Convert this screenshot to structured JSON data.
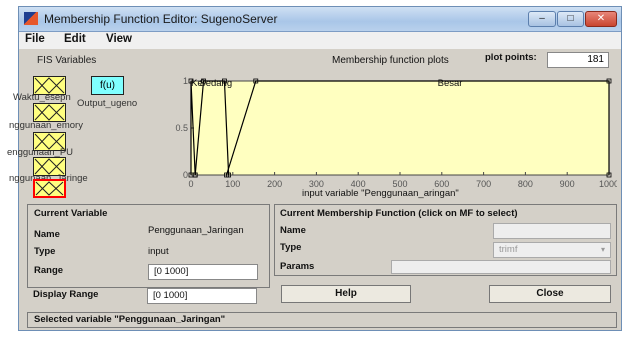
{
  "window": {
    "title": "Membership Function Editor: SugenoServer"
  },
  "menu": [
    "File",
    "Edit",
    "View"
  ],
  "fis": {
    "label": "FIS Variables",
    "output_box": "f(u)",
    "output_name": "Output_ugeno",
    "inputs": [
      "Waktu_eseon",
      "Penggunaan_emory",
      "Penggunaan_PU",
      "Penggunaan_Jaringan",
      "Penggunaan_Jaringan"
    ],
    "input_label_visible": [
      "Waktu_esepn",
      "nggunaan_emory",
      "enggunaan_PU",
      "nggunaan_Jaringe",
      "enggunaan_Jaringa"
    ]
  },
  "plot": {
    "title": "Membership function plots",
    "points_label": "plot points:",
    "points_value": "181",
    "xlabel": "input variable \"Penggunaan_aringan\""
  },
  "chart_data": {
    "type": "line",
    "title": "Membership function plots",
    "xlabel": "input variable \"Penggunaan_aringan\"",
    "ylabel": "",
    "xlim": [
      0,
      1000
    ],
    "ylim": [
      0,
      1
    ],
    "xticks": [
      0,
      100,
      200,
      300,
      400,
      500,
      600,
      700,
      800,
      900,
      1000
    ],
    "yticks": [
      0,
      0.5,
      1
    ],
    "background": "#ffffc0",
    "grid": false,
    "series": [
      {
        "name": "Kecil",
        "x": [
          0,
          0,
          10
        ],
        "y": [
          0,
          1,
          0
        ]
      },
      {
        "name": "Sedang",
        "x": [
          10,
          30,
          80,
          90
        ],
        "y": [
          0,
          1,
          1,
          0
        ]
      },
      {
        "name": "Besar",
        "x": [
          85,
          155,
          1000,
          1000
        ],
        "y": [
          0,
          1,
          1,
          0
        ]
      }
    ],
    "mf_labels": [
      {
        "text": "Ke",
        "x": 0
      },
      {
        "text": "Sedang",
        "x": 20
      },
      {
        "text": "Besar",
        "x": 590
      }
    ]
  },
  "current_variable": {
    "header": "Current Variable",
    "name_label": "Name",
    "name_value": "Penggunaan_Jaringan",
    "type_label": "Type",
    "type_value": "input",
    "range_label": "Range",
    "range_value": "[0 1000]",
    "display_range_label": "Display Range",
    "display_range_value": "[0 1000]"
  },
  "current_mf": {
    "header": "Current Membership Function (click on MF to select)",
    "name_label": "Name",
    "name_value": "",
    "type_label": "Type",
    "type_value": "trimf",
    "params_label": "Params",
    "params_value": ""
  },
  "buttons": {
    "help": "Help",
    "close": "Close"
  },
  "status": "Selected variable \"Penggunaan_Jaringan\""
}
